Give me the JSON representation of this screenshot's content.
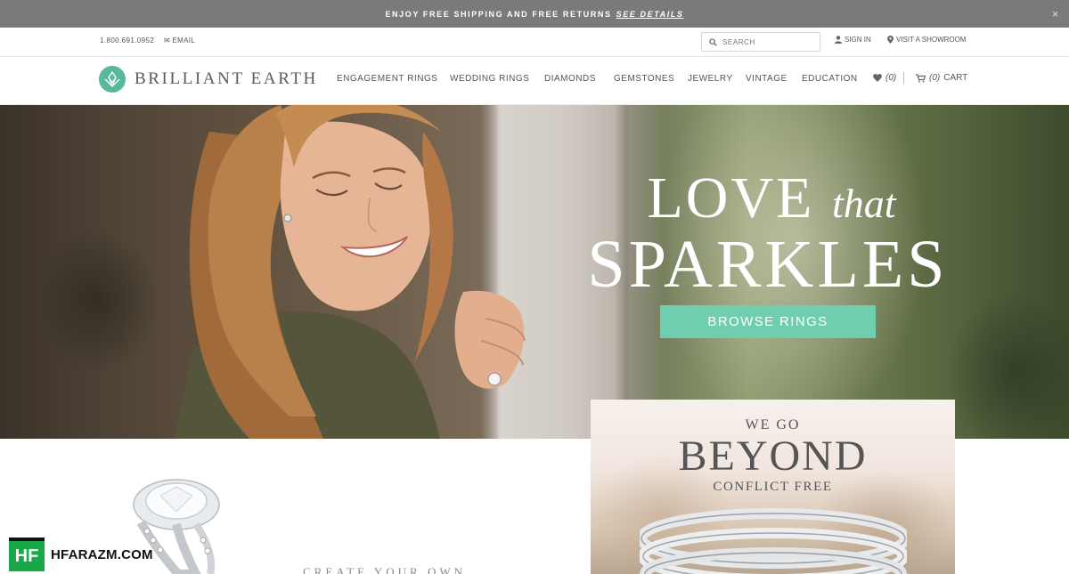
{
  "promo": {
    "text": "ENJOY FREE SHIPPING AND FREE RETURNS",
    "link": "SEE DETAILS",
    "close": "×"
  },
  "utility": {
    "phone": "1.800.691.0952",
    "email": "EMAIL",
    "search_placeholder": "SEARCH",
    "sign_in": "SIGN IN",
    "showroom": "VISIT A SHOWROOM"
  },
  "brand": {
    "name": "BRILLIANT EARTH",
    "accent": "#6fceb0",
    "logo_color": "#58b89c"
  },
  "nav": {
    "items": [
      {
        "label": "ENGAGEMENT RINGS"
      },
      {
        "label": "WEDDING RINGS"
      },
      {
        "label": "DIAMONDS"
      },
      {
        "label": "GEMSTONES"
      },
      {
        "label": "JEWELRY"
      },
      {
        "label": "VINTAGE"
      },
      {
        "label": "EDUCATION"
      }
    ],
    "favorites_count": "(0)",
    "cart_count": "(0)",
    "cart_label": "CART"
  },
  "hero": {
    "line1_main": "LOVE",
    "line1_script": "that",
    "line2": "SPARKLES",
    "cta": "BROWSE RINGS"
  },
  "lower": {
    "create_text": "CREATE YOUR OWN",
    "beyond_top": "WE GO",
    "beyond_main": "BEYOND",
    "beyond_bottom": "CONFLICT FREE"
  },
  "watermark": {
    "logo": "HF",
    "site": "HFARAZM.COM"
  },
  "icons": [
    "envelope-icon",
    "search-icon",
    "user-icon",
    "map-pin-icon",
    "heart-icon",
    "cart-icon",
    "close-icon",
    "logo-icon"
  ]
}
